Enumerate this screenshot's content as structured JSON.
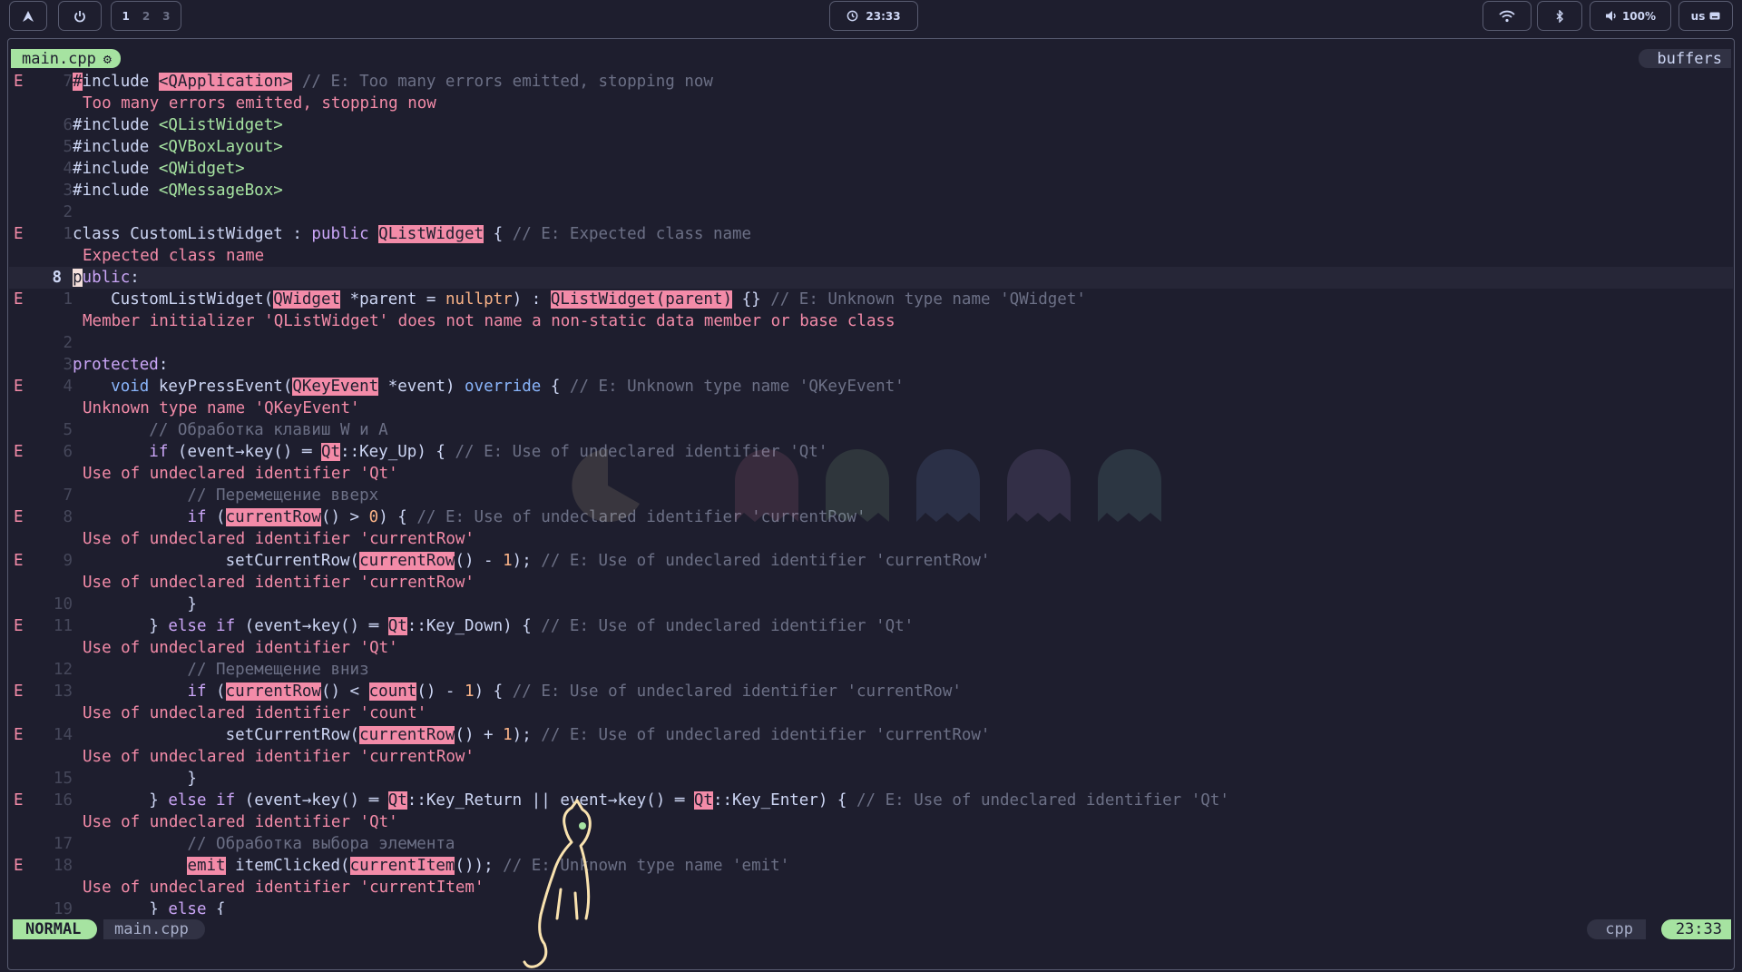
{
  "colors": {
    "background": "#1e1e2e",
    "accent_green": "#a6e3a1",
    "error_red": "#f38ba8",
    "keyword": "#cba6f7",
    "type_blue": "#89b4fa",
    "comment": "#6c7086"
  },
  "topbar": {
    "launcher_icon": "arch-icon",
    "power_icon": "power-icon",
    "workspaces": [
      "1",
      "2",
      "3"
    ],
    "active_workspace": "1",
    "clock_icon": "clock-icon",
    "clock": "23:33",
    "wifi_icon": "wifi-icon",
    "bluetooth_icon": "bluetooth-icon",
    "volume_icon": "volume-icon",
    "volume": "100%",
    "keyboard_layout": "us",
    "keyboard_icon": "keyboard-icon"
  },
  "tabline": {
    "active_tab": "main.cpp",
    "tab_icon": "gear-icon",
    "buffers_label": "buffers"
  },
  "statusline": {
    "mode": "NORMAL",
    "file": "main.cpp",
    "filetype": "cpp",
    "time": "23:33"
  },
  "editor": {
    "lines": [
      {
        "sign": "E",
        "num": "7"
      },
      {
        "sign": "",
        "num": "",
        "virt": "Too many errors emitted, stopping now"
      },
      {
        "sign": "",
        "num": "6"
      },
      {
        "sign": "",
        "num": "5"
      },
      {
        "sign": "",
        "num": "4"
      },
      {
        "sign": "",
        "num": "3"
      },
      {
        "sign": "",
        "num": "2"
      },
      {
        "sign": "E",
        "num": "1"
      },
      {
        "sign": "",
        "num": "",
        "virt": "Expected class name"
      },
      {
        "sign": "",
        "num": "8"
      },
      {
        "sign": "E",
        "num": "1"
      },
      {
        "sign": "",
        "num": "",
        "virt": "Member initializer 'QListWidget' does not name a non-static data member or base class"
      },
      {
        "sign": "",
        "num": "2"
      },
      {
        "sign": "",
        "num": "3"
      },
      {
        "sign": "E",
        "num": "4"
      },
      {
        "sign": "",
        "num": "",
        "virt": "Unknown type name 'QKeyEvent'"
      },
      {
        "sign": "",
        "num": "5"
      },
      {
        "sign": "E",
        "num": "6"
      },
      {
        "sign": "",
        "num": "",
        "virt": "Use of undeclared identifier 'Qt'"
      },
      {
        "sign": "",
        "num": "7"
      },
      {
        "sign": "E",
        "num": "8"
      },
      {
        "sign": "",
        "num": "",
        "virt": "Use of undeclared identifier 'currentRow'"
      },
      {
        "sign": "E",
        "num": "9"
      },
      {
        "sign": "",
        "num": "",
        "virt": "Use of undeclared identifier 'currentRow'"
      },
      {
        "sign": "",
        "num": "10"
      },
      {
        "sign": "E",
        "num": "11"
      },
      {
        "sign": "",
        "num": "",
        "virt": "Use of undeclared identifier 'Qt'"
      },
      {
        "sign": "",
        "num": "12"
      },
      {
        "sign": "E",
        "num": "13"
      },
      {
        "sign": "",
        "num": "",
        "virt": "Use of undeclared identifier 'count'"
      },
      {
        "sign": "E",
        "num": "14"
      },
      {
        "sign": "",
        "num": "",
        "virt": "Use of undeclared identifier 'currentRow'"
      },
      {
        "sign": "",
        "num": "15"
      },
      {
        "sign": "E",
        "num": "16"
      },
      {
        "sign": "",
        "num": "",
        "virt": "Use of undeclared identifier 'Qt'"
      },
      {
        "sign": "",
        "num": "17"
      },
      {
        "sign": "E",
        "num": "18"
      },
      {
        "sign": "",
        "num": "",
        "virt": "Use of undeclared identifier 'currentItem'"
      },
      {
        "sign": "",
        "num": "19"
      }
    ],
    "code": {
      "l0": [
        [
          "kw-cur",
          "#"
        ],
        [
          "",
          "include "
        ],
        [
          "err",
          "<QApplication>"
        ],
        [
          "cmt",
          " // E: Too many errors emitted, stopping now"
        ]
      ],
      "l2": [
        [
          "",
          "#include "
        ],
        [
          "str",
          "<QListWidget>"
        ]
      ],
      "l3": [
        [
          "",
          "#include "
        ],
        [
          "str",
          "<QVBoxLayout>"
        ]
      ],
      "l4": [
        [
          "",
          "#include "
        ],
        [
          "str",
          "<QWidget>"
        ]
      ],
      "l5": [
        [
          "",
          "#include "
        ],
        [
          "str",
          "<QMessageBox>"
        ]
      ],
      "l7": [
        [
          "",
          "class CustomListWidget : "
        ],
        [
          "kw",
          "public"
        ],
        [
          "",
          " "
        ],
        [
          "err",
          "QListWidget"
        ],
        [
          "",
          " { "
        ],
        [
          "cmt",
          "// E: Expected class name"
        ]
      ],
      "l9": [
        [
          "cursor",
          "p"
        ],
        [
          "kw",
          "ublic"
        ],
        [
          "",
          ":"
        ]
      ],
      "l10": [
        [
          "",
          "    CustomListWidget("
        ],
        [
          "err",
          "QWidget"
        ],
        [
          "",
          " *parent = "
        ],
        [
          "num",
          "nullptr"
        ],
        [
          "",
          ") : "
        ],
        [
          "err",
          "QListWidget(parent)"
        ],
        [
          "",
          " {} "
        ],
        [
          "cmt",
          "// E: Unknown type name 'QWidget'"
        ]
      ],
      "l13": [
        [
          "kw",
          "protected"
        ],
        [
          "",
          ":"
        ]
      ],
      "l14": [
        [
          "",
          "    "
        ],
        [
          "kw2",
          "void"
        ],
        [
          "",
          " keyPressEvent("
        ],
        [
          "err",
          "QKeyEvent"
        ],
        [
          "",
          " *event) "
        ],
        [
          "kw2",
          "override"
        ],
        [
          "",
          " { "
        ],
        [
          "cmt",
          "// E: Unknown type name 'QKeyEvent'"
        ]
      ],
      "l16": [
        [
          "cmt",
          "        // Обработка клавиш W и A"
        ]
      ],
      "l17": [
        [
          "",
          "        "
        ],
        [
          "kw",
          "if"
        ],
        [
          "",
          " (event→key() ═ "
        ],
        [
          "err",
          "Qt"
        ],
        [
          "",
          "::Key_Up) { "
        ],
        [
          "cmt",
          "// E: Use of undeclared identifier 'Qt'"
        ]
      ],
      "l19": [
        [
          "cmt",
          "            // Перемещение вверх"
        ]
      ],
      "l20": [
        [
          "",
          "            "
        ],
        [
          "kw",
          "if"
        ],
        [
          "",
          " ("
        ],
        [
          "err",
          "currentRow"
        ],
        [
          "",
          "() > "
        ],
        [
          "num",
          "0"
        ],
        [
          "",
          ") { "
        ],
        [
          "cmt",
          "// E: Use of undeclared identifier 'currentRow'"
        ]
      ],
      "l22": [
        [
          "",
          "                setCurrentRow("
        ],
        [
          "err",
          "currentRow"
        ],
        [
          "",
          "() - "
        ],
        [
          "num",
          "1"
        ],
        [
          "",
          "); "
        ],
        [
          "cmt",
          "// E: Use of undeclared identifier 'currentRow'"
        ]
      ],
      "l24": [
        [
          "",
          "            }"
        ]
      ],
      "l25": [
        [
          "",
          "        } "
        ],
        [
          "kw",
          "else if"
        ],
        [
          "",
          " (event→key() ═ "
        ],
        [
          "err",
          "Qt"
        ],
        [
          "",
          "::Key_Down) { "
        ],
        [
          "cmt",
          "// E: Use of undeclared identifier 'Qt'"
        ]
      ],
      "l27": [
        [
          "cmt",
          "            // Перемещение вниз"
        ]
      ],
      "l28": [
        [
          "",
          "            "
        ],
        [
          "kw",
          "if"
        ],
        [
          "",
          " ("
        ],
        [
          "err",
          "currentRow"
        ],
        [
          "",
          "() < "
        ],
        [
          "err",
          "count"
        ],
        [
          "",
          "() - "
        ],
        [
          "num",
          "1"
        ],
        [
          "",
          ") { "
        ],
        [
          "cmt",
          "// E: Use of undeclared identifier 'currentRow'"
        ]
      ],
      "l30": [
        [
          "",
          "                setCurrentRow("
        ],
        [
          "err",
          "currentRow"
        ],
        [
          "",
          "() + "
        ],
        [
          "num",
          "1"
        ],
        [
          "",
          "); "
        ],
        [
          "cmt",
          "// E: Use of undeclared identifier 'currentRow'"
        ]
      ],
      "l32": [
        [
          "",
          "            }"
        ]
      ],
      "l33": [
        [
          "",
          "        } "
        ],
        [
          "kw",
          "else if"
        ],
        [
          "",
          " (event→key() ═ "
        ],
        [
          "err",
          "Qt"
        ],
        [
          "",
          "::Key_Return || event→key() ═ "
        ],
        [
          "err",
          "Qt"
        ],
        [
          "",
          "::Key_Enter) { "
        ],
        [
          "cmt",
          "// E: Use of undeclared identifier 'Qt'"
        ]
      ],
      "l35": [
        [
          "cmt",
          "            // Обработка выбора элемента"
        ]
      ],
      "l36": [
        [
          "",
          "            "
        ],
        [
          "err",
          "emit"
        ],
        [
          "",
          " itemClicked("
        ],
        [
          "err",
          "currentItem"
        ],
        [
          "",
          "()); "
        ],
        [
          "cmt",
          "// E: Unknown type name 'emit'"
        ]
      ],
      "l38": [
        [
          "",
          "        } "
        ],
        [
          "kw",
          "else"
        ],
        [
          "",
          " {"
        ]
      ]
    }
  }
}
